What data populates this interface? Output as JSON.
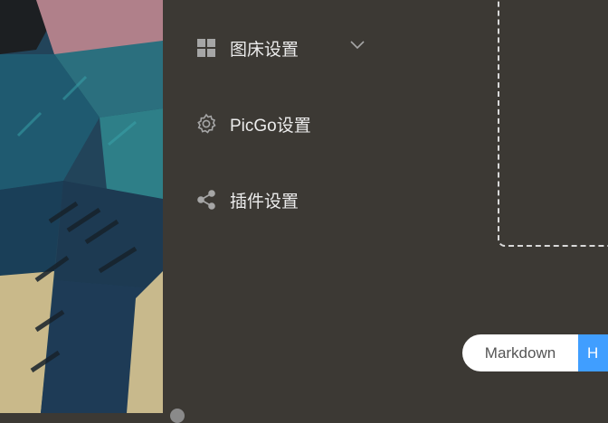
{
  "sidebar": {
    "items": [
      {
        "label": "图床设置",
        "icon": "grid-icon",
        "has_submenu": true
      },
      {
        "label": "PicGo设置",
        "icon": "gear-icon",
        "has_submenu": false
      },
      {
        "label": "插件设置",
        "icon": "share-icon",
        "has_submenu": false
      }
    ]
  },
  "link_format": {
    "options": [
      "Markdown",
      "H"
    ],
    "selected": "HTML"
  },
  "colors": {
    "background": "#3c3934",
    "accent": "#409eff",
    "text": "#ececec",
    "icon": "#a6a6a6"
  }
}
